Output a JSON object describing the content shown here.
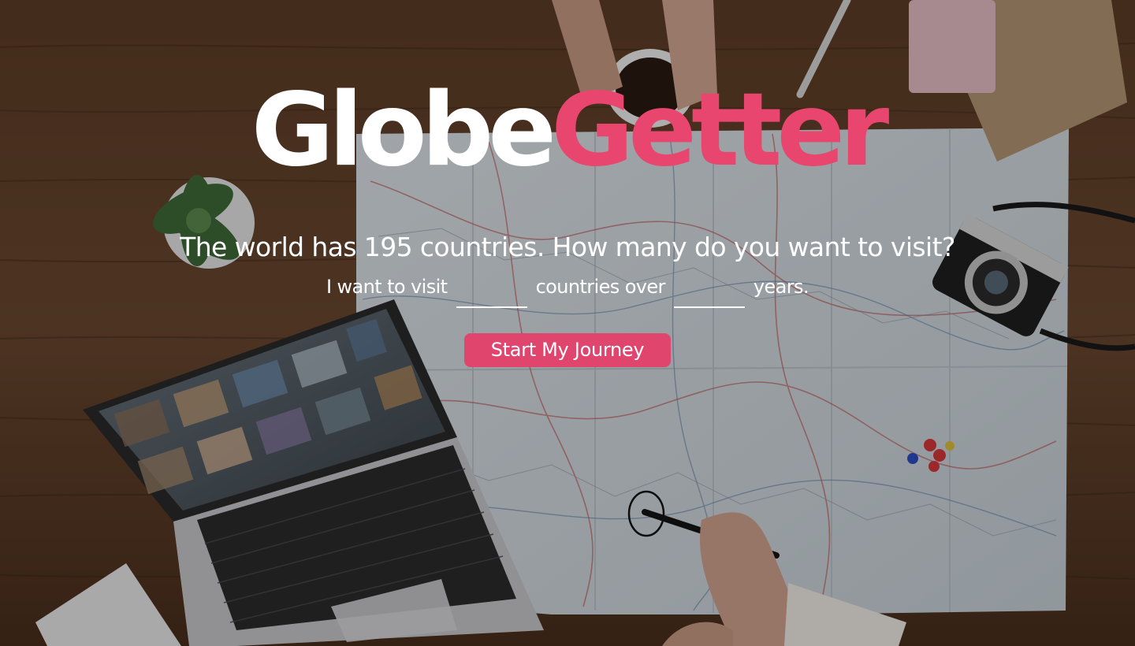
{
  "brand": {
    "logo_part_1": "Globe",
    "logo_part_2": "Getter",
    "logo_part_1_color": "#ffffff",
    "logo_part_2_color": "#e9466f"
  },
  "hero": {
    "headline": "The world has 195 countries. How many do you want to visit?",
    "sentence_part_1": "I want to visit",
    "sentence_part_2": "countries over",
    "sentence_part_3": "years.",
    "countries_input": {
      "value": "",
      "placeholder": ""
    },
    "years_input": {
      "value": "",
      "placeholder": ""
    },
    "cta_label": "Start My Journey",
    "cta_color": "#e0456e"
  },
  "background": {
    "description_icons": [
      "wood-desk",
      "paper-map",
      "laptop",
      "camera",
      "coffee-cup",
      "succulent-plant",
      "pen",
      "notebook",
      "map-pins"
    ]
  }
}
